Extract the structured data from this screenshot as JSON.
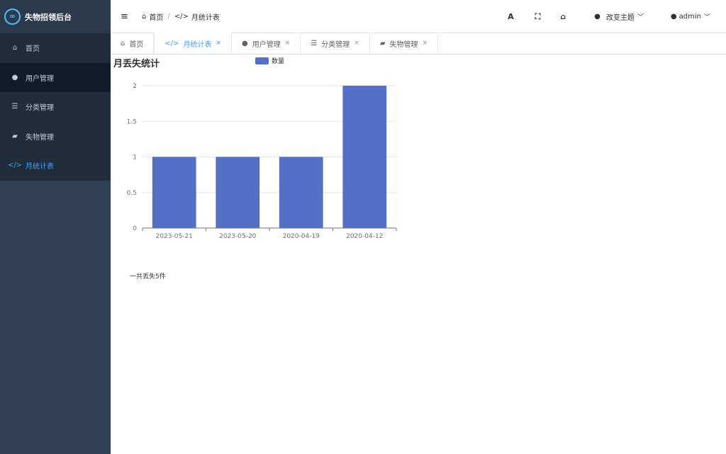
{
  "app": {
    "title": "失物招领后台",
    "logo_glyph": "∞"
  },
  "sidebar": {
    "items": [
      {
        "label": "首页",
        "icon": "home-icon",
        "glyph": "⌂"
      },
      {
        "label": "用户管理",
        "icon": "user-icon",
        "glyph": "●"
      },
      {
        "label": "分类管理",
        "icon": "list-icon",
        "glyph": "☰"
      },
      {
        "label": "失物管理",
        "icon": "truck-icon",
        "glyph": "▰"
      },
      {
        "label": "月统计表",
        "icon": "code-icon",
        "glyph": "</>"
      }
    ]
  },
  "navbar": {
    "hamburger_glyph": "≡",
    "breadcrumb": [
      {
        "label": "首页",
        "glyph": "⌂"
      },
      {
        "label": "月统计表",
        "glyph": "</>"
      }
    ],
    "breadcrumb_sep": "/",
    "font_size_glyph": "A",
    "fullscreen_glyph": "⛶",
    "home_glyph": "⌂",
    "theme_label": "改变主题",
    "user_label": "admin"
  },
  "tabs": [
    {
      "label": "首页",
      "glyph": "⌂",
      "closable": false
    },
    {
      "label": "月统计表",
      "glyph": "</>",
      "closable": true
    },
    {
      "label": "用户管理",
      "glyph": "●",
      "closable": true
    },
    {
      "label": "分类管理",
      "glyph": "☰",
      "closable": true
    },
    {
      "label": "失物管理",
      "glyph": "▰",
      "closable": true
    }
  ],
  "close_glyph": "×",
  "colors": {
    "accent": "#409eff",
    "bar": "#5470c6",
    "sidebar": "#304156"
  },
  "chart_data": {
    "type": "bar",
    "title": "月丢失统计",
    "categories": [
      "2023-05-21",
      "2023-05-20",
      "2020-04-19",
      "2020-04-12"
    ],
    "series": [
      {
        "name": "数量",
        "values": [
          1,
          1,
          1,
          2
        ]
      }
    ],
    "ylim": [
      0,
      2
    ],
    "yticks": [
      0,
      0.5,
      1,
      1.5,
      2
    ],
    "legend": "top",
    "grid": true
  },
  "summary": "一共丢失5件"
}
